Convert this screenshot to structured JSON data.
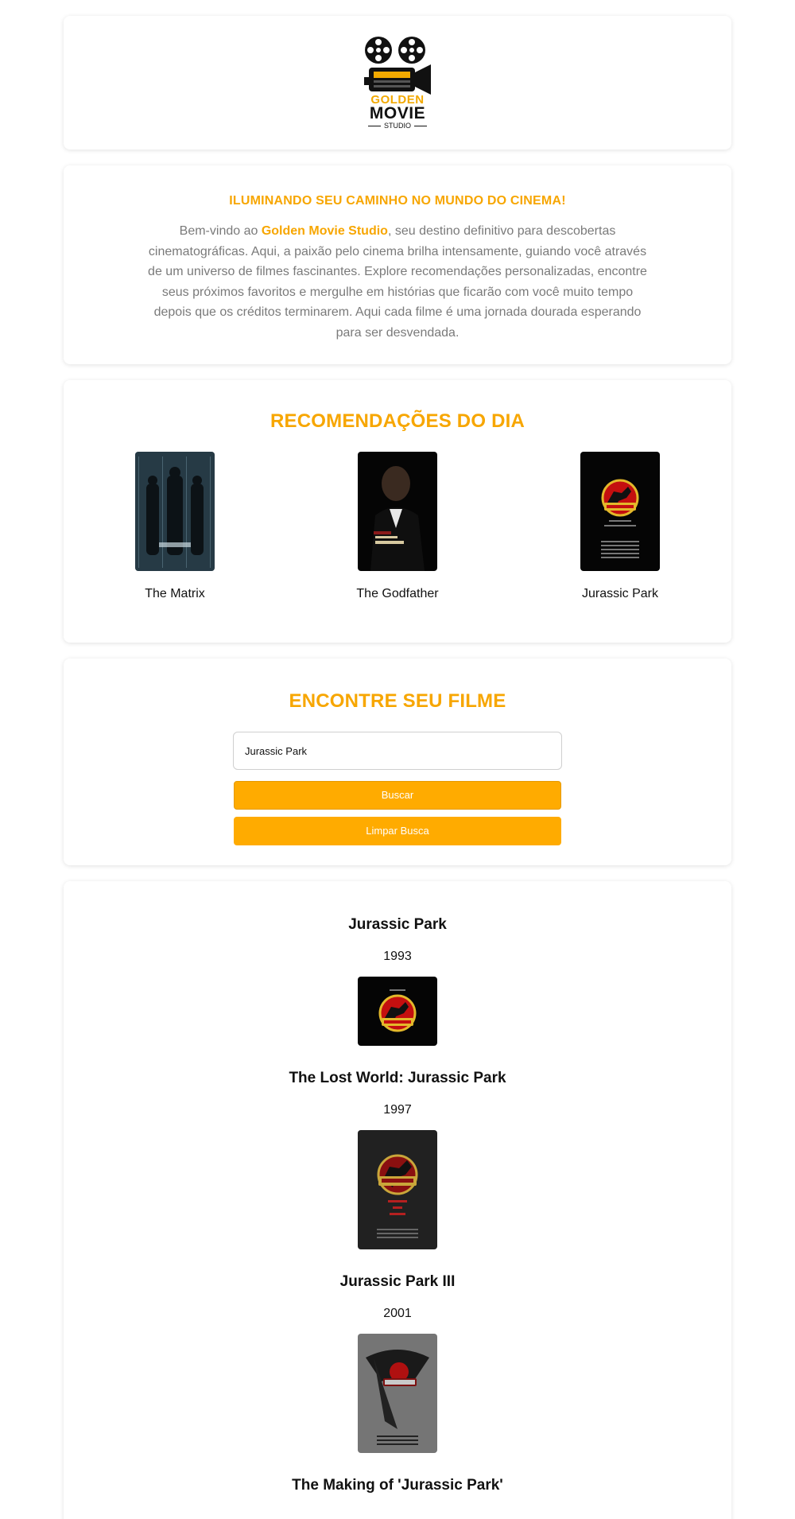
{
  "header": {
    "logo_line1": "GOLDEN",
    "logo_line2": "MOVIE",
    "logo_line3": "STUDIO"
  },
  "intro": {
    "title": "ILUMINANDO SEU CAMINHO NO MUNDO DO CINEMA!",
    "text_before": "Bem-vindo ao ",
    "brand": "Golden Movie Studio",
    "text_after": ", seu destino definitivo para descobertas cinematográficas. Aqui, a paixão pelo cinema brilha intensamente, guiando você através de um universo de filmes fascinantes. Explore recomendações personalizadas, encontre seus próximos favoritos e mergulhe em histórias que ficarão com você muito tempo depois que os créditos terminarem. Aqui cada filme é uma jornada dourada esperando para ser desvendada."
  },
  "recommendations": {
    "title": "RECOMENDAÇÕES DO DIA",
    "items": [
      {
        "title": "The Matrix",
        "poster_icon": "matrix-poster"
      },
      {
        "title": "The Godfather",
        "poster_icon": "godfather-poster"
      },
      {
        "title": "Jurassic Park",
        "poster_icon": "jurassic-park-poster"
      }
    ]
  },
  "search": {
    "title": "ENCONTRE SEU FILME",
    "input_value": "Jurassic Park",
    "search_button": "Buscar",
    "clear_button": "Limpar Busca"
  },
  "results": [
    {
      "title": "Jurassic Park",
      "year": "1993"
    },
    {
      "title": "The Lost World: Jurassic Park",
      "year": "1997"
    },
    {
      "title": "Jurassic Park III",
      "year": "2001"
    },
    {
      "title": "The Making of 'Jurassic Park'",
      "year": ""
    }
  ],
  "colors": {
    "accent": "#f7a600",
    "button": "#ffab00",
    "muted_text": "#7a7a7a"
  }
}
